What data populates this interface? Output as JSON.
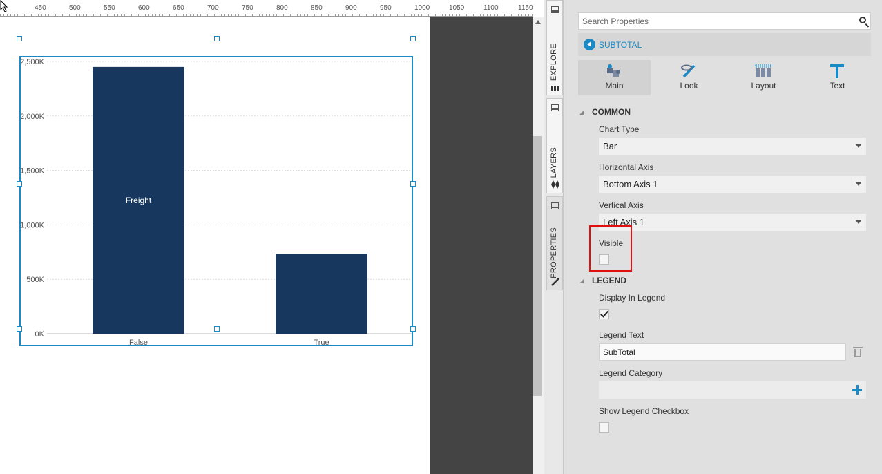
{
  "ruler": {
    "labels": [
      "450",
      "500",
      "550",
      "600",
      "650",
      "700",
      "750",
      "800",
      "850",
      "900",
      "950",
      "1000",
      "1050",
      "1100",
      "1150"
    ]
  },
  "chart_data": {
    "type": "bar",
    "categories": [
      "False",
      "True"
    ],
    "series": [
      {
        "values": [
          2450,
          735
        ]
      }
    ],
    "bar_labels": [
      "Freight",
      ""
    ],
    "yticks": [
      "0K",
      "500K",
      "1,000K",
      "1,500K",
      "2,000K",
      "2,500K"
    ],
    "ylim": [
      0,
      2500
    ],
    "grid": true,
    "bar_color": "#17375e"
  },
  "sidetabs": {
    "explore": "EXPLORE",
    "layers": "LAYERS",
    "properties": "PROPERTIES"
  },
  "panel": {
    "search_placeholder": "Search Properties",
    "breadcrumb": "SUBTOTAL",
    "tabs": {
      "main": "Main",
      "look": "Look",
      "layout": "Layout",
      "text": "Text"
    },
    "common": {
      "header": "COMMON",
      "chart_type_label": "Chart Type",
      "chart_type_value": "Bar",
      "horizontal_axis_label": "Horizontal Axis",
      "horizontal_axis_value": "Bottom Axis 1",
      "vertical_axis_label": "Vertical Axis",
      "vertical_axis_value": "Left Axis 1",
      "visible_label": "Visible",
      "visible_checked": false
    },
    "legend": {
      "header": "LEGEND",
      "display_in_legend_label": "Display In Legend",
      "display_in_legend_checked": true,
      "legend_text_label": "Legend Text",
      "legend_text_value": "SubTotal",
      "legend_category_label": "Legend Category",
      "show_legend_checkbox_label": "Show Legend Checkbox",
      "show_legend_checkbox_checked": false
    },
    "accent_color": "#1a8ac6",
    "highlight_color": "#e01010"
  }
}
